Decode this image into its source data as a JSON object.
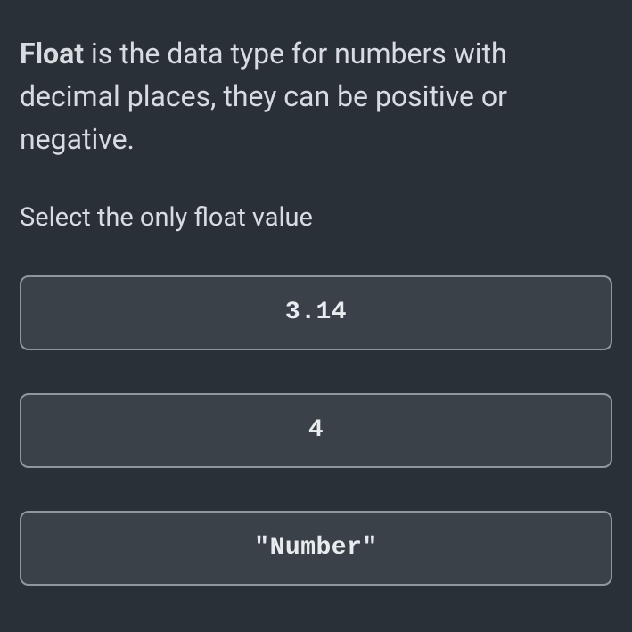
{
  "intro": {
    "term": "Float",
    "description": " is the data type for numbers with decimal places, they can be positive or negative."
  },
  "question": "Select the only float value",
  "options": [
    {
      "label": "3.14"
    },
    {
      "label": "4"
    },
    {
      "label": "\"Number\""
    }
  ]
}
